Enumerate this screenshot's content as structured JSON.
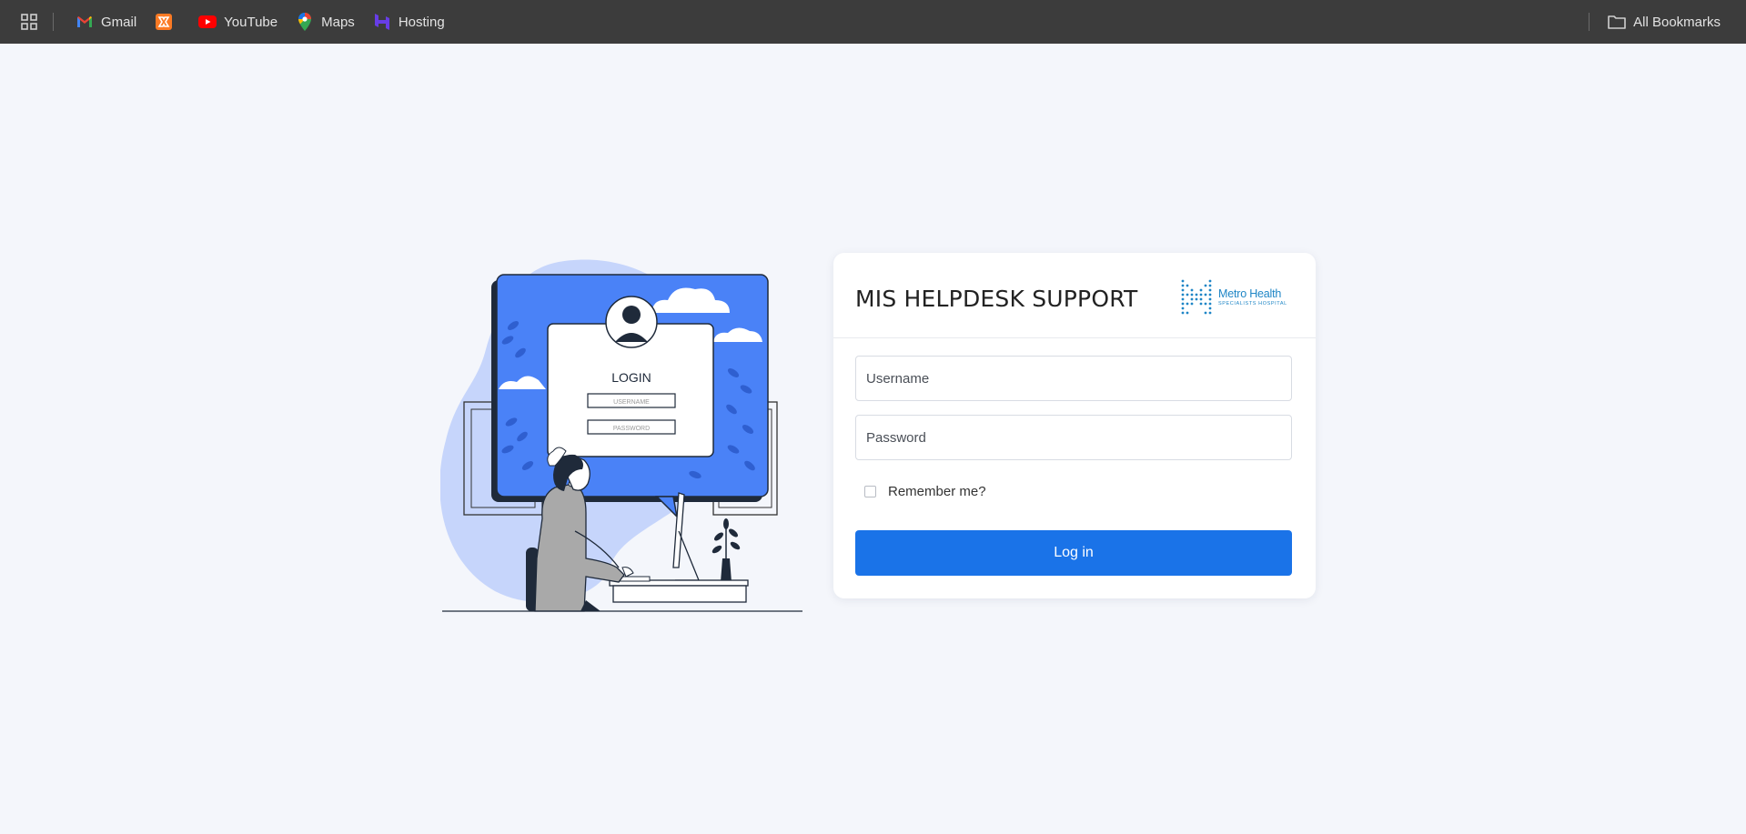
{
  "bookmarks": {
    "apps_icon": "apps-grid-icon",
    "items": [
      {
        "label": "Gmail",
        "icon": "gmail-icon"
      },
      {
        "label": "",
        "icon": "xampp-icon"
      },
      {
        "label": "YouTube",
        "icon": "youtube-icon"
      },
      {
        "label": "Maps",
        "icon": "maps-icon"
      },
      {
        "label": "Hosting",
        "icon": "hostinger-icon"
      }
    ],
    "all_bookmarks": {
      "label": "All Bookmarks",
      "icon": "folder-icon"
    }
  },
  "illustration": {
    "login_title": "LOGIN",
    "username_placeholder": "USERNAME",
    "password_placeholder": "PASSWORD"
  },
  "login": {
    "title": "MIS HELPDESK SUPPORT",
    "logo_name": "Metro Health",
    "logo_sub": "SPECIALISTS HOSPITAL",
    "username_placeholder": "Username",
    "password_placeholder": "Password",
    "remember_label": "Remember me?",
    "submit_label": "Log in"
  },
  "colors": {
    "accent": "#1a73e8",
    "illustration_blue": "#4a82f7",
    "blob": "#c6d5fb",
    "logo": "#1f86c6"
  }
}
